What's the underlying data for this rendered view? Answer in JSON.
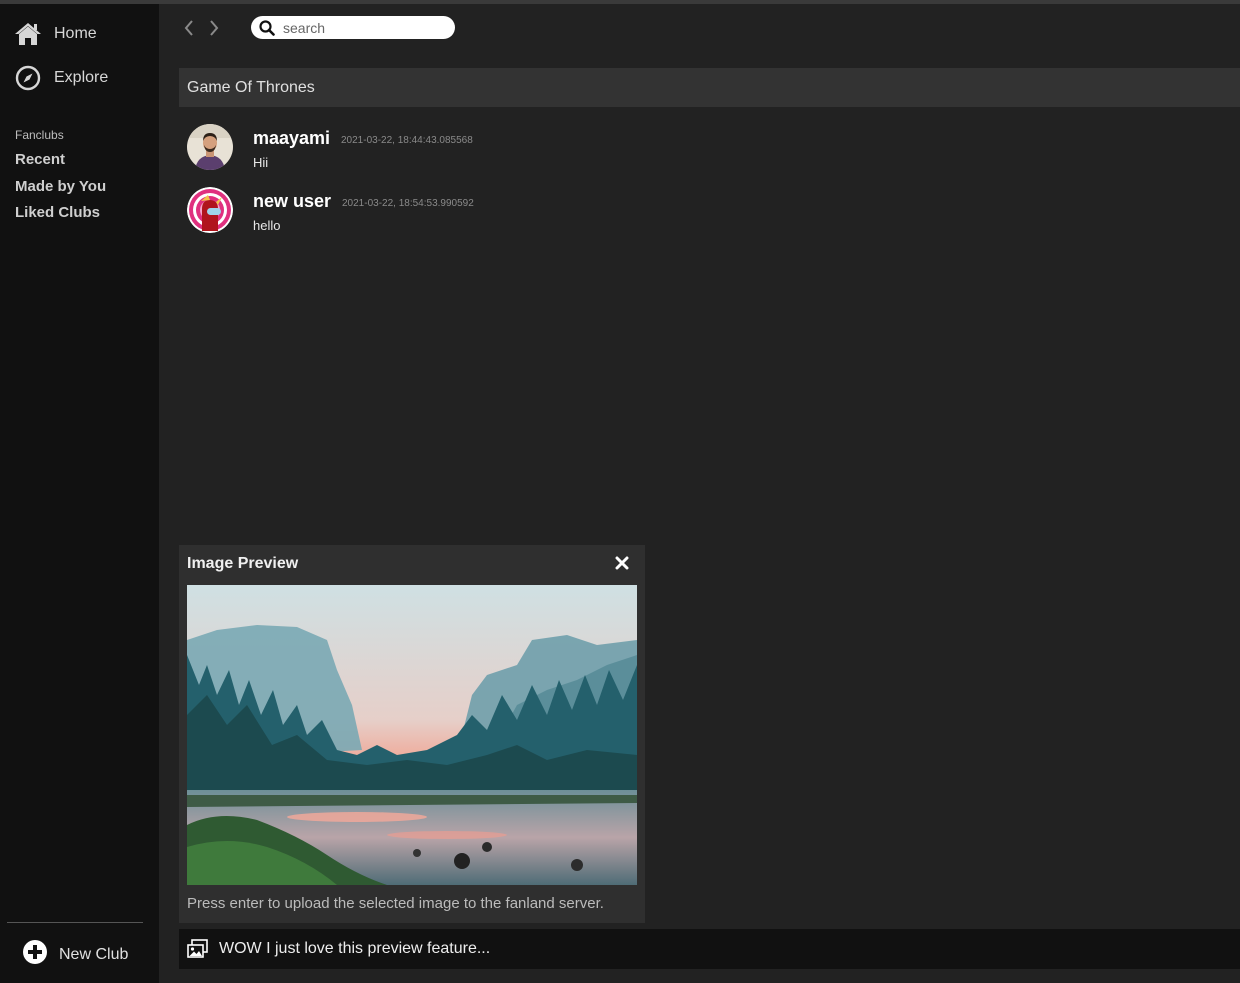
{
  "sidebar": {
    "home_label": "Home",
    "explore_label": "Explore",
    "section_title": "Fanclubs",
    "links": [
      "Recent",
      "Made by You",
      "Liked Clubs"
    ],
    "new_club_label": "New Club"
  },
  "search": {
    "placeholder": "search"
  },
  "channel": {
    "title": "Game Of Thrones"
  },
  "messages": [
    {
      "user": "maayami",
      "timestamp": "2021-03-22, 18:44:43.085568",
      "text": "Hii"
    },
    {
      "user": "new user",
      "timestamp": "2021-03-22, 18:54:53.990592",
      "text": "hello"
    }
  ],
  "preview": {
    "title": "Image Preview",
    "note": "Press enter to upload the selected image to the fanland server."
  },
  "composer": {
    "value": "WOW I just love this preview feature..."
  },
  "icons": {
    "home": "home-icon",
    "explore": "compass-icon",
    "new_club": "plus-circle-icon",
    "back": "chevron-left-icon",
    "forward": "chevron-right-icon",
    "search": "search-icon",
    "close": "close-icon",
    "image": "image-upload-icon"
  },
  "colors": {
    "sidebar_bg": "#111111",
    "main_bg": "#222222",
    "header_bg": "#333333",
    "preview_bg": "#2f2f2f"
  }
}
